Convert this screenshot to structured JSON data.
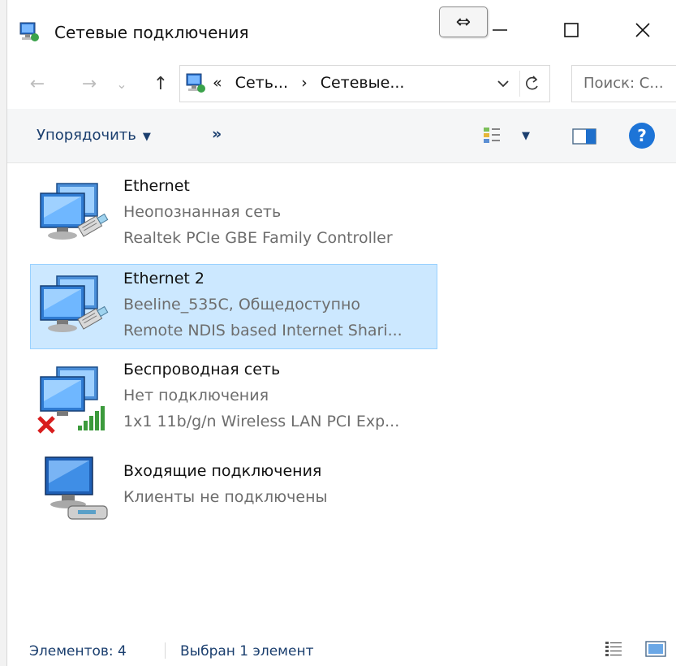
{
  "window": {
    "title": "Сетевые подключения",
    "title_icon": "network-connections-icon",
    "controls": [
      "minimize-icon",
      "maximize-icon",
      "close-icon"
    ],
    "resize_tooltip_glyph": "⇔"
  },
  "nav": {
    "back_glyph": "←",
    "forward_glyph": "→",
    "recent_glyph": "⌄",
    "up_glyph": "↑"
  },
  "address": {
    "overflow": "«",
    "crumbs": [
      "Сеть...",
      "Сетевые..."
    ],
    "separator": "›"
  },
  "search": {
    "placeholder": "Поиск: С..."
  },
  "toolbar": {
    "organize_label": "Упорядочить",
    "more_label": "»"
  },
  "items": [
    {
      "name": "Ethernet",
      "status": "Неопознанная сеть",
      "device": "Realtek PCIe GBE Family Controller",
      "icon": "ethernet-adapter-icon",
      "selected": false
    },
    {
      "name": "Ethernet 2",
      "status": "Beeline_535C, Общедоступно",
      "device": "Remote NDIS based Internet Shari...",
      "icon": "ethernet-adapter-icon",
      "selected": true
    },
    {
      "name": "Беспроводная сеть",
      "status": "Нет подключения",
      "device": "1x1 11b/g/n Wireless LAN PCI Exp...",
      "icon": "wireless-adapter-disconnected-icon",
      "selected": false
    },
    {
      "name": "Входящие подключения",
      "status": "Клиенты не подключены",
      "icon": "incoming-connections-icon",
      "selected": false
    }
  ],
  "status": {
    "count": "Элементов: 4",
    "selection": "Выбран 1 элемент"
  },
  "colors": {
    "accent": "#1d74d7",
    "selection_bg": "#cce8ff",
    "selection_border": "#99d1ff",
    "link_text": "#1a3e6e"
  }
}
